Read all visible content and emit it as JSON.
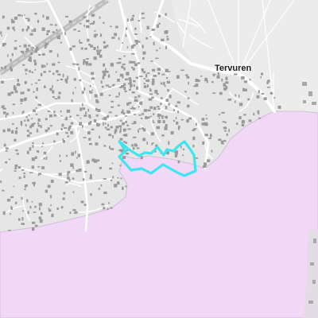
{
  "map": {
    "place_label": "Tervuren",
    "colors": {
      "land": "#e6e6e6",
      "forest": "#f0d8f6",
      "forest_edge": "#cfc0d4",
      "roads": "#ffffff",
      "buildings": "#9a9a9a",
      "railway": "#bdbdbd",
      "route": "#3fe6ee"
    }
  }
}
